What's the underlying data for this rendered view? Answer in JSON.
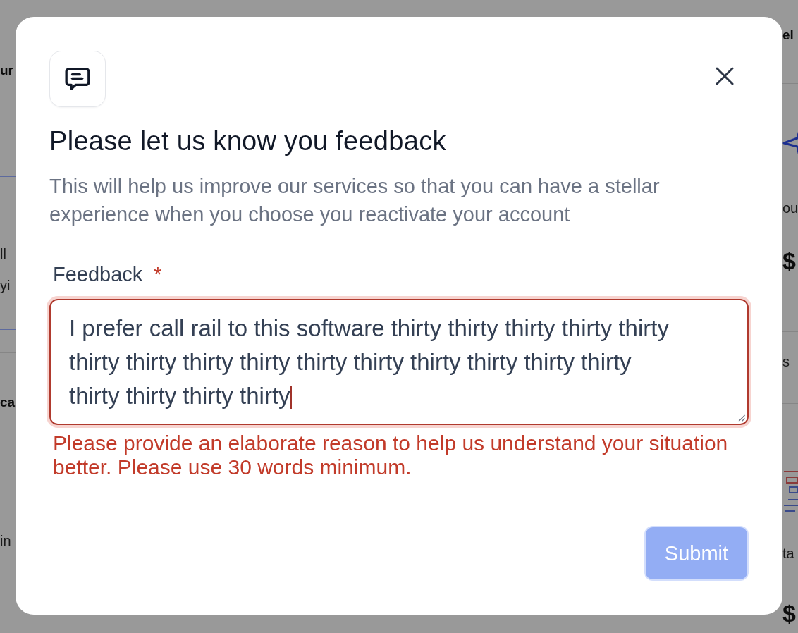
{
  "background_page": {
    "left_texts": [
      {
        "text": "ur",
        "kind": "heading"
      },
      {
        "text": "ll",
        "kind": "body"
      },
      {
        "text": "yi",
        "kind": "body"
      },
      {
        "text": "ca",
        "kind": "heading"
      },
      {
        "text": "in",
        "kind": "body"
      }
    ],
    "right_texts": [
      {
        "text": "el",
        "kind": "heading"
      },
      {
        "text": "ou",
        "kind": "body"
      },
      {
        "text": "$",
        "kind": "amount"
      },
      {
        "text": "s",
        "kind": "body"
      },
      {
        "text": "ta",
        "kind": "body"
      },
      {
        "text": "$",
        "kind": "amount"
      }
    ]
  },
  "dialog": {
    "title": "Please let us know you feedback",
    "description": "This will help us improve our services so that you can have a stellar experience when you choose you reactivate your account",
    "field": {
      "label": "Feedback",
      "required_mark": "*",
      "value": "I prefer call rail to this software thirty thirty thirty thirty thirty thirty thirty thirty thirty thirty thirty thirty thirty thirty thirty thirty thirty thirty thirty",
      "focused": true,
      "invalid": true,
      "error": "Please provide an elaborate reason to help us understand your situation better. Please use 30 words minimum."
    },
    "submit": {
      "label": "Submit",
      "disabled": true
    }
  }
}
